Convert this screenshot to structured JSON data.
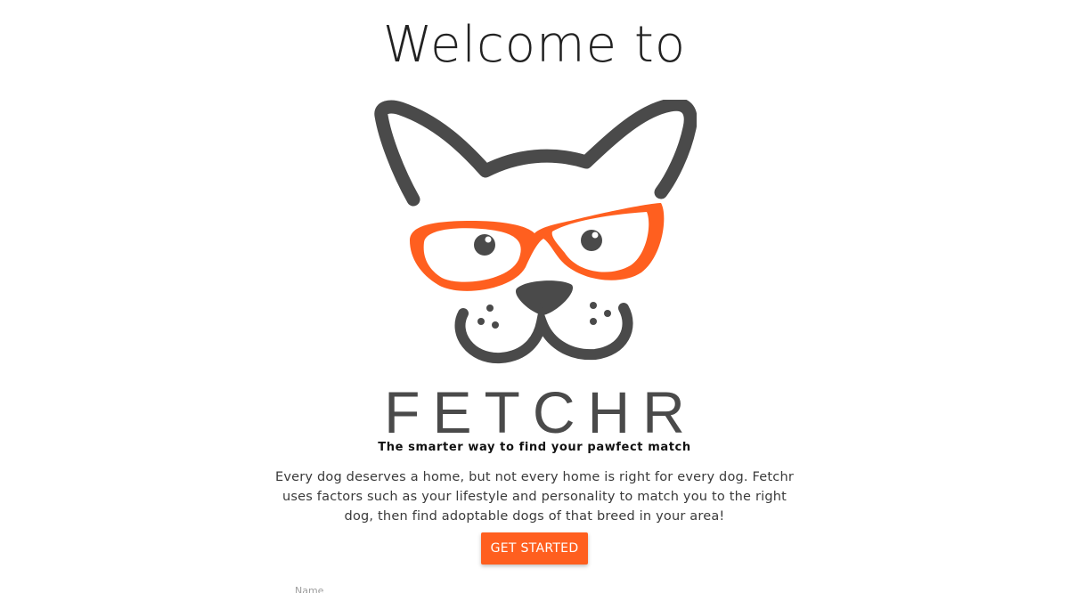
{
  "header": {
    "title": "Welcome to"
  },
  "logo": {
    "brand": "FETCHR",
    "tagline": "The smarter way to find your pawfect match"
  },
  "intro": {
    "description": "Every dog deserves a home, but not every home is right for every dog. Fetchr uses factors such as your lifestyle and personality to match you to the right dog, then find adoptable dogs of that breed in your area!"
  },
  "actions": {
    "get_started_label": "GET STARTED"
  },
  "form": {
    "name_label": "Name"
  },
  "colors": {
    "accent": "#ff5f1f",
    "logo_gray": "#4a4a4a"
  },
  "icons": {
    "logo": "dog-with-glasses-icon"
  }
}
